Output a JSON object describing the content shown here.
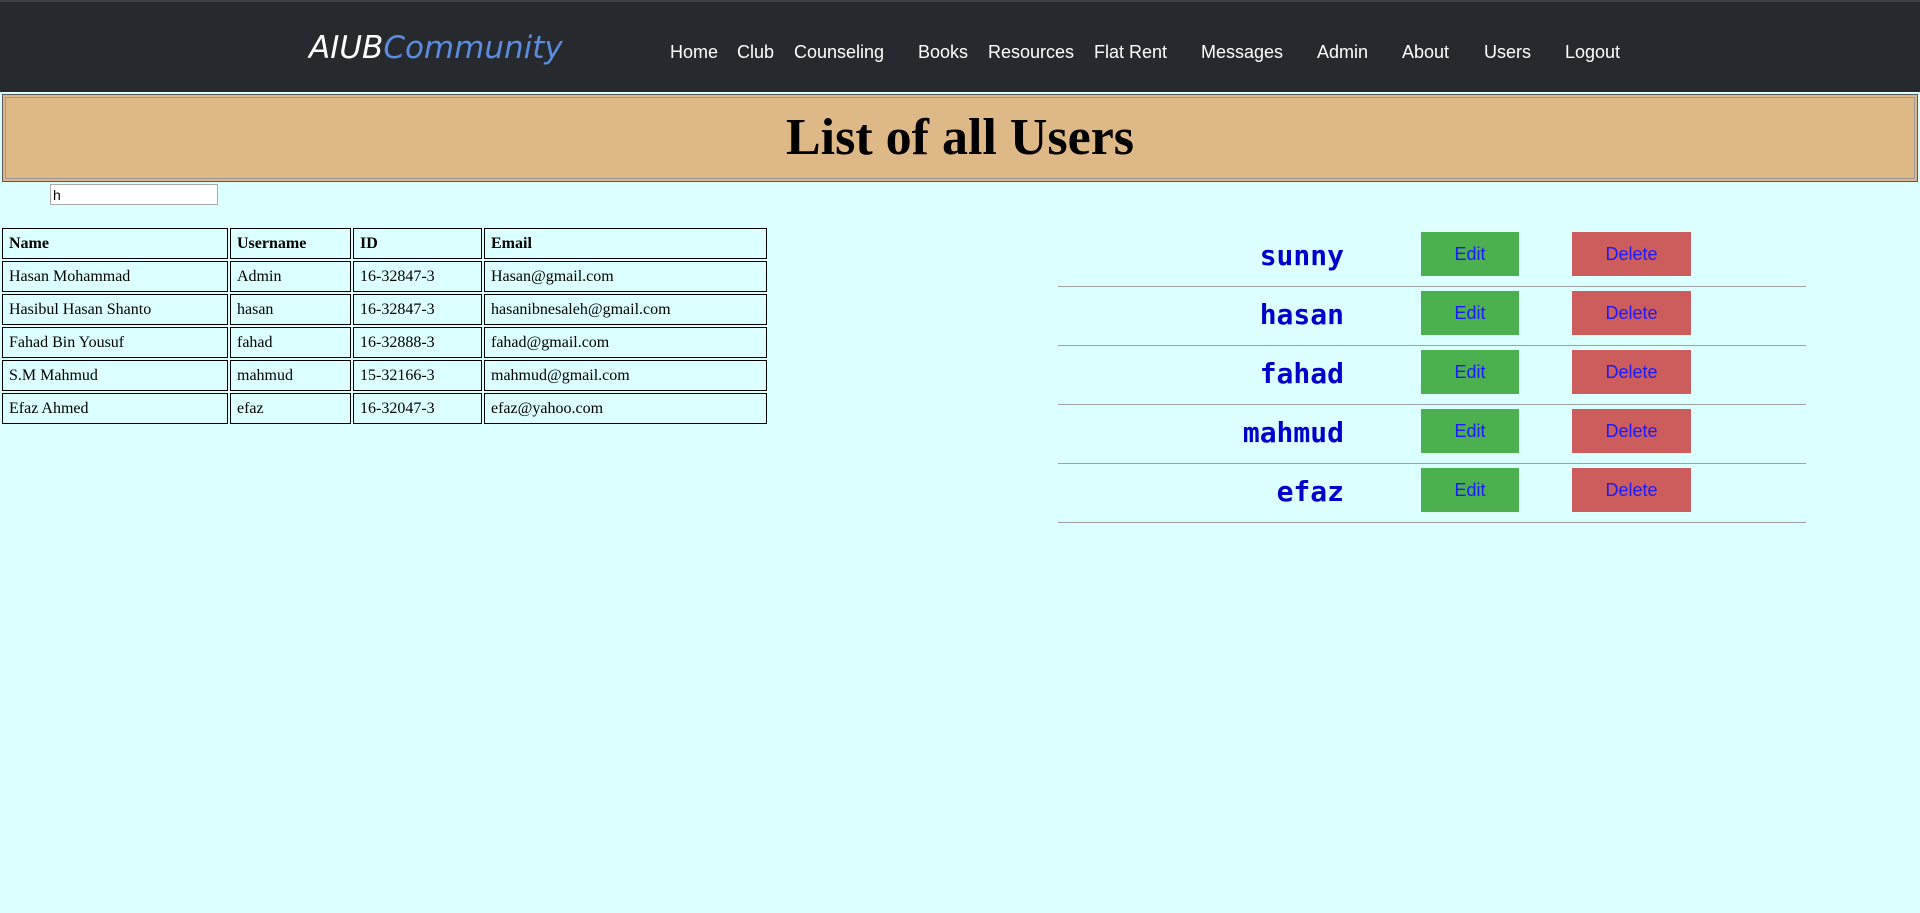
{
  "header": {
    "brand_part1": "AIUB",
    "brand_part2": "Community",
    "nav": [
      "Home",
      "Club",
      "Counseling",
      "Books",
      "Resources",
      "Flat Rent",
      "Messages",
      "Admin",
      "About",
      "Users",
      "Logout"
    ]
  },
  "banner": {
    "title": "List of all Users"
  },
  "search": {
    "value": "h"
  },
  "table": {
    "headers": [
      "Name",
      "Username",
      "ID",
      "Email"
    ],
    "rows": [
      [
        "Hasan Mohammad",
        "Admin",
        "16-32847-3",
        "Hasan@gmail.com"
      ],
      [
        "Hasibul Hasan Shanto",
        "hasan",
        "16-32847-3",
        "hasanibnesaleh@gmail.com"
      ],
      [
        "Fahad Bin Yousuf",
        "fahad",
        "16-32888-3",
        "fahad@gmail.com"
      ],
      [
        "S.M Mahmud",
        "mahmud",
        "15-32166-3",
        "mahmud@gmail.com"
      ],
      [
        "Efaz Ahmed",
        "efaz",
        "16-32047-3",
        "efaz@yahoo.com"
      ]
    ]
  },
  "user_list": {
    "items": [
      {
        "username": "sunny",
        "edit_label": "Edit",
        "delete_label": "Delete"
      },
      {
        "username": "hasan",
        "edit_label": "Edit",
        "delete_label": "Delete"
      },
      {
        "username": "fahad",
        "edit_label": "Edit",
        "delete_label": "Delete"
      },
      {
        "username": "mahmud",
        "edit_label": "Edit",
        "delete_label": "Delete"
      },
      {
        "username": "efaz",
        "edit_label": "Edit",
        "delete_label": "Delete"
      }
    ]
  },
  "colors": {
    "page_background": "#dcffff",
    "topbar": "#262a2e",
    "brand_accent": "#5b8bdf",
    "banner": "#deb887",
    "edit_button": "#4caf50",
    "delete_button": "#cd5c5c",
    "username_text": "#0000cc"
  }
}
